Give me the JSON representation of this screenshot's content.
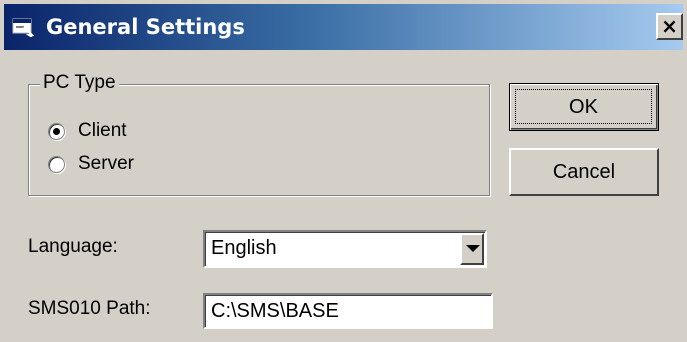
{
  "window": {
    "title": "General Settings",
    "close_label": "×",
    "title_icon": "app-window-icon",
    "colors": {
      "titlebar_start": "#0a246a",
      "titlebar_end": "#a6caf0",
      "face": "#d4d0c8"
    }
  },
  "pc_type": {
    "legend": "PC Type",
    "options": [
      {
        "label": "Client",
        "checked": true
      },
      {
        "label": "Server",
        "checked": false
      }
    ]
  },
  "buttons": {
    "ok": "OK",
    "cancel": "Cancel"
  },
  "language": {
    "label": "Language:",
    "value": "English"
  },
  "sms_path": {
    "label": "SMS010 Path:",
    "value": "C:\\SMS\\BASE"
  }
}
